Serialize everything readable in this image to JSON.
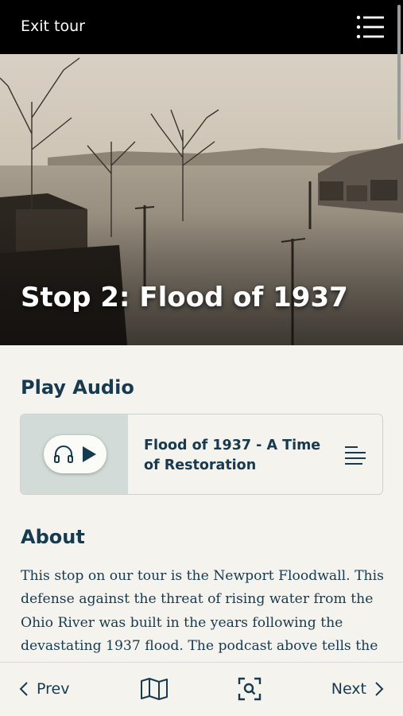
{
  "header": {
    "exit_label": "Exit tour",
    "menu_icon": "list-menu-icon"
  },
  "hero": {
    "title": "Stop 2: Flood of 1937",
    "image": "sepia-flood-photo"
  },
  "audio": {
    "section_heading": "Play Audio",
    "track_title": "Flood of 1937 - A Time of Restoration",
    "icons": [
      "headphones-icon",
      "play-icon",
      "transcript-icon"
    ]
  },
  "about": {
    "section_heading": "About",
    "text": "This stop on our tour is the Newport Floodwall. This defense against the threat of rising water from the Ohio River was built in the years following the devastating 1937 flood. The podcast above tells the"
  },
  "bottom_nav": {
    "prev_label": "Prev",
    "next_label": "Next",
    "icons": [
      "chevron-left-icon",
      "map-icon",
      "scan-search-icon",
      "chevron-right-icon"
    ]
  },
  "colors": {
    "header_bg": "#000000",
    "page_bg": "#f4f3ee",
    "heading_text": "#163a4f",
    "audio_left_bg": "#d3dbd8"
  }
}
